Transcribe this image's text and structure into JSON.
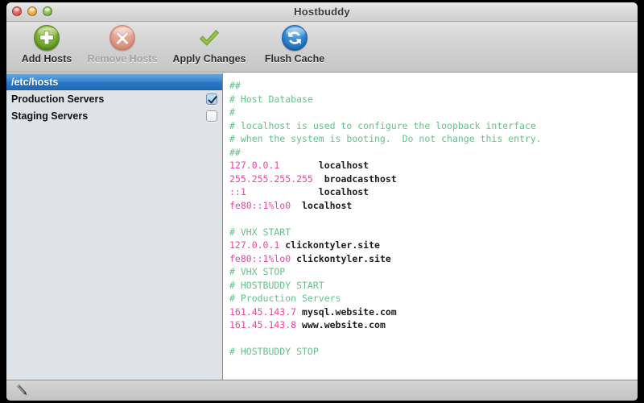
{
  "window": {
    "title": "Hostbuddy",
    "traffic_lights": [
      {
        "name": "close",
        "color": "#d9544c"
      },
      {
        "name": "minimize",
        "color": "#e8a13a"
      },
      {
        "name": "zoom",
        "color": "#7cb544"
      }
    ]
  },
  "toolbar": {
    "items": [
      {
        "label": "Add Hosts",
        "icon": "plus-circle-icon",
        "enabled": true,
        "color": "#76ab2e"
      },
      {
        "label": "Remove Hosts",
        "icon": "x-circle-icon",
        "enabled": false,
        "color": "#e09c89"
      },
      {
        "label": "Apply Changes",
        "icon": "checkmark-icon",
        "enabled": true,
        "color": "#7fae39"
      },
      {
        "label": "Flush Cache",
        "icon": "refresh-circle-icon",
        "enabled": true,
        "color": "#2b82cf"
      }
    ]
  },
  "sidebar": {
    "rows": [
      {
        "label": "/etc/hosts",
        "selected": true,
        "has_checkbox": false,
        "checked": false
      },
      {
        "label": "Production Servers",
        "selected": false,
        "has_checkbox": true,
        "checked": true
      },
      {
        "label": "Staging Servers",
        "selected": false,
        "has_checkbox": true,
        "checked": false
      }
    ]
  },
  "editor": {
    "lines": [
      [
        {
          "t": "##",
          "c": "comment"
        }
      ],
      [
        {
          "t": "# Host Database",
          "c": "comment"
        }
      ],
      [
        {
          "t": "#",
          "c": "comment"
        }
      ],
      [
        {
          "t": "# localhost is used to configure the loopback interface",
          "c": "comment"
        }
      ],
      [
        {
          "t": "# when the system is booting.  Do not change this entry.",
          "c": "comment"
        }
      ],
      [
        {
          "t": "##",
          "c": "comment"
        }
      ],
      [
        {
          "t": "127.0.0.1",
          "c": "ip"
        },
        {
          "t": "       localhost",
          "c": "host"
        }
      ],
      [
        {
          "t": "255.255.255.255",
          "c": "ip"
        },
        {
          "t": "  broadcasthost",
          "c": "host"
        }
      ],
      [
        {
          "t": "::1",
          "c": "ip"
        },
        {
          "t": "             localhost",
          "c": "host"
        }
      ],
      [
        {
          "t": "fe80::1%lo0",
          "c": "ip"
        },
        {
          "t": "  localhost",
          "c": "host"
        }
      ],
      [
        {
          "t": "",
          "c": "comment"
        }
      ],
      [
        {
          "t": "# VHX START",
          "c": "comment"
        }
      ],
      [
        {
          "t": "127.0.0.1",
          "c": "ip"
        },
        {
          "t": " clickontyler.site",
          "c": "host"
        }
      ],
      [
        {
          "t": "fe80::1%lo0",
          "c": "ip"
        },
        {
          "t": " clickontyler.site",
          "c": "host"
        }
      ],
      [
        {
          "t": "# VHX STOP",
          "c": "comment"
        }
      ],
      [
        {
          "t": "# HOSTBUDDY START",
          "c": "comment"
        }
      ],
      [
        {
          "t": "# Production Servers",
          "c": "comment"
        }
      ],
      [
        {
          "t": "161.45.143.7",
          "c": "ip"
        },
        {
          "t": " mysql.website.com",
          "c": "host"
        }
      ],
      [
        {
          "t": "161.45.143.8",
          "c": "ip"
        },
        {
          "t": " www.website.com",
          "c": "host"
        }
      ],
      [
        {
          "t": "",
          "c": "comment"
        }
      ],
      [
        {
          "t": "# HOSTBUDDY STOP",
          "c": "comment"
        }
      ]
    ],
    "colors": {
      "comment": "#63c28a",
      "ip": "#e8489e",
      "hostname": "#1c1c1c",
      "background": "#ffffff"
    }
  },
  "statusbar": {
    "edit_icon": "pencil-icon"
  }
}
